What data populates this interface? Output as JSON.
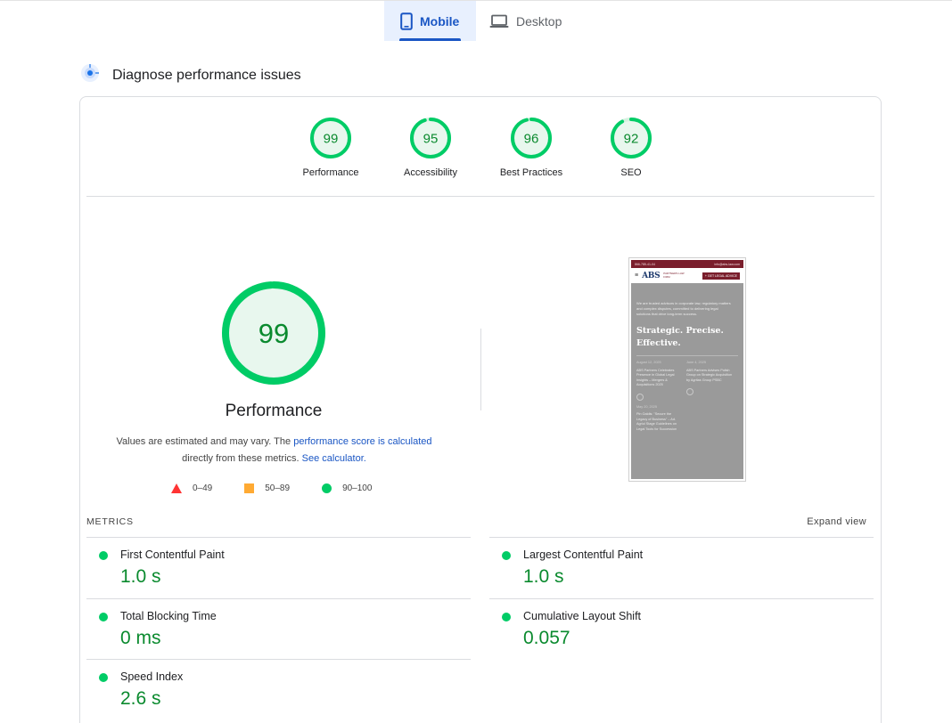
{
  "tabs": [
    {
      "label": "Mobile",
      "active": true,
      "icon": "phone-icon"
    },
    {
      "label": "Desktop",
      "active": false,
      "icon": "laptop-icon"
    }
  ],
  "header": {
    "title": "Diagnose performance issues",
    "icon": "diagnose-icon"
  },
  "scores": [
    {
      "label": "Performance",
      "value": 99
    },
    {
      "label": "Accessibility",
      "value": 95
    },
    {
      "label": "Best Practices",
      "value": 96
    },
    {
      "label": "SEO",
      "value": 92
    }
  ],
  "main_score": {
    "label": "Performance",
    "value": 99
  },
  "estimate": {
    "prefix": "Values are estimated and may vary. The ",
    "link1": "performance score is calculated",
    "middle": "directly from these metrics.",
    "link2": "See calculator."
  },
  "legend": [
    {
      "shape": "triangle",
      "range": "0–49",
      "color": "#ff3333"
    },
    {
      "shape": "square",
      "range": "50–89",
      "color": "#ffaa33"
    },
    {
      "shape": "circle",
      "range": "90–100",
      "color": "#00cc66"
    }
  ],
  "metrics_header": "METRICS",
  "expand_label": "Expand view",
  "metrics": {
    "left": [
      {
        "name": "First Contentful Paint",
        "value": "1.0 s"
      },
      {
        "name": "Total Blocking Time",
        "value": "0 ms"
      },
      {
        "name": "Speed Index",
        "value": "2.6 s"
      }
    ],
    "right": [
      {
        "name": "Largest Contentful Paint",
        "value": "1.0 s"
      },
      {
        "name": "Cumulative Layout Shift",
        "value": "0.057"
      }
    ]
  },
  "screenshot": {
    "topbar_left": "866-785-41-04",
    "topbar_right": "info@abs-law.com",
    "logo": "ABS",
    "logo_sub": "PARTNERS LAW FIRM",
    "cta": "+ GET LEGAL ADVICE",
    "intro": "We are trusted advisors in corporate law, regulatory matters and complex disputes, committed to delivering legal solutions that drive long-term success.",
    "headline": "Strategic. Precise. Effective.",
    "news": [
      {
        "date": "August 12, 2025",
        "text": "ABS Partners Celebrates Presence in Global Legal Insights – Mergers & Acquisitions 2025"
      },
      {
        "date": "June 4, 2025",
        "text": "ABS Partners Advises Polish Group on Strategic Acquisition by Agritas Group PSBC"
      },
      {
        "date": "May 20, 2025",
        "text": "Pin Galdis: \"Secure the Legacy of Business\" – Ad. Agriul Stage Guidelines on Legal Tools for Succession"
      }
    ]
  },
  "colors": {
    "pass": "#00cc66",
    "pass_text": "#0a8a2e",
    "pass_fill": "#e8f7ee",
    "accent": "#1a56c4"
  }
}
